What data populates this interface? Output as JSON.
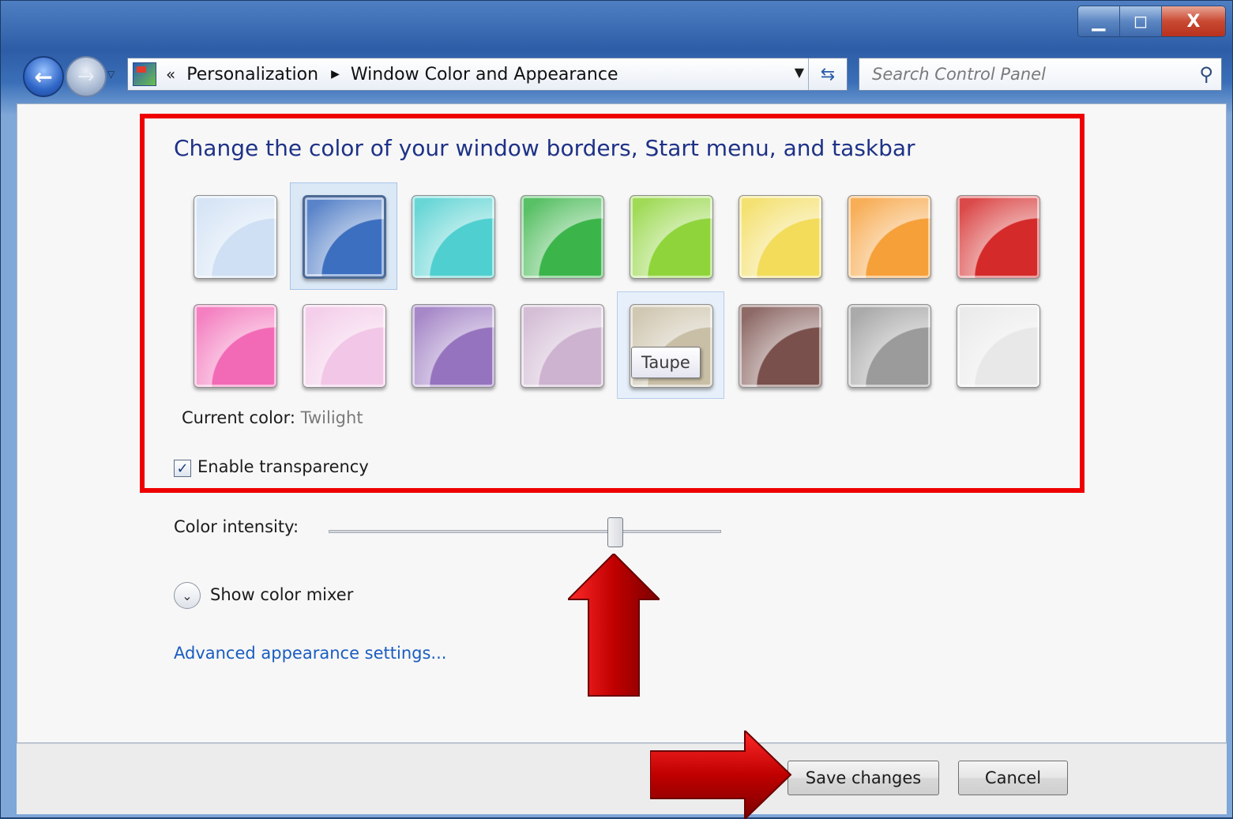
{
  "window": {
    "caption_minimize": "▁",
    "caption_maximize": "◻",
    "caption_close": "X"
  },
  "nav": {
    "breadcrumb_prefix": "«",
    "breadcrumbs": [
      "Personalization",
      "Window Color and Appearance"
    ],
    "breadcrumb_separator": "▶",
    "search_placeholder": "Search Control Panel"
  },
  "content": {
    "heading": "Change the color of your window borders, Start menu, and taskbar",
    "swatches": [
      {
        "color": "#cfe0f4",
        "selected": false
      },
      {
        "color": "#3d6fc0",
        "selected": true
      },
      {
        "color": "#4fcfcf",
        "selected": false
      },
      {
        "color": "#3bb54a",
        "selected": false
      },
      {
        "color": "#8fd43a",
        "selected": false
      },
      {
        "color": "#f2dc5a",
        "selected": false
      },
      {
        "color": "#f6a03a",
        "selected": false
      },
      {
        "color": "#d52a2a",
        "selected": false
      },
      {
        "color": "#f26ab6",
        "selected": false
      },
      {
        "color": "#f2c6e6",
        "selected": false
      },
      {
        "color": "#9673be",
        "selected": false
      },
      {
        "color": "#cdb3cf",
        "selected": false
      },
      {
        "color": "#c9bfa6",
        "selected": false,
        "hover": true
      },
      {
        "color": "#7a504c",
        "selected": false
      },
      {
        "color": "#9b9b9b",
        "selected": false
      },
      {
        "color": "#e8e8e8",
        "selected": false
      }
    ],
    "tooltip": "Taupe",
    "current_color_label": "Current color:",
    "current_color_value": "Twilight",
    "transparency_checked": true,
    "transparency_label": "Enable transparency",
    "intensity_label": "Color intensity:",
    "intensity_value": 0.73,
    "mixer_label": "Show color mixer",
    "advanced_link": "Advanced appearance settings..."
  },
  "footer": {
    "save_label": "Save changes",
    "cancel_label": "Cancel"
  },
  "colors": {
    "highlight": "#ee0000",
    "arrow": "#c00000",
    "heading": "#1e3287",
    "link": "#1a5dc0"
  }
}
